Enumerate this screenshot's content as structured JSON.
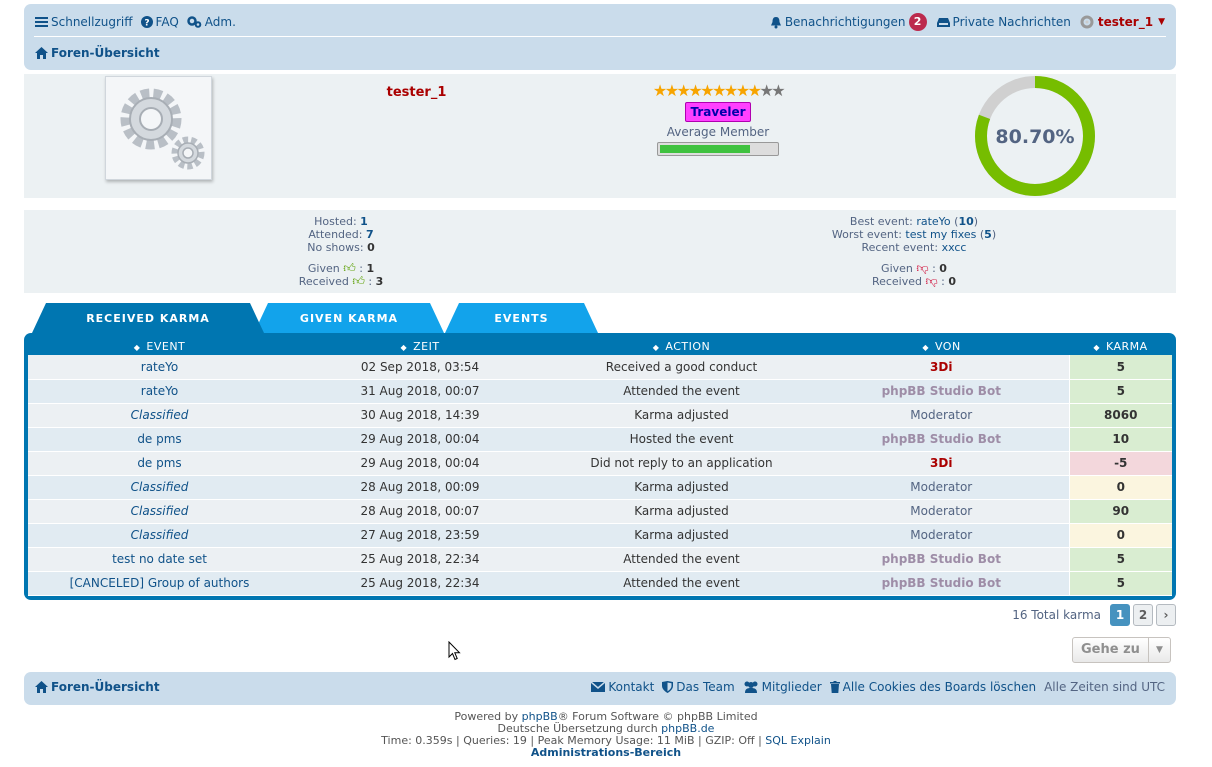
{
  "header": {
    "quicklinks": "Schnellzugriff",
    "faq": "FAQ",
    "adm": "Adm.",
    "notifications": "Benachrichtigungen",
    "notif_count": "2",
    "pm": "Private Nachrichten",
    "username": "tester_1",
    "breadcrumb": "Foren-Übersicht"
  },
  "profile": {
    "name": "tester_1",
    "stars_on": 9,
    "stars_total": 11,
    "rank": "Traveler",
    "rank_title": "Average Member",
    "rank_progress": 0.78,
    "percent": "80.70%",
    "percent_value": 80.7
  },
  "stats": {
    "hosted_label": "Hosted:",
    "hosted": "1",
    "attended_label": "Attended:",
    "attended": "7",
    "noshow_label": "No shows:",
    "noshow": "0",
    "given_label": "Given",
    "given_up": "1",
    "received_label": "Received",
    "received_up": "3",
    "best_label": "Best event:",
    "best_name": "rateYo",
    "best_val": "10",
    "worst_label": "Worst event:",
    "worst_name": "test my fixes",
    "worst_val": "5",
    "recent_label": "Recent event:",
    "recent_name": "xxcc",
    "given_down": "0",
    "received_down": "0"
  },
  "tabs": [
    "RECEIVED KARMA",
    "GIVEN KARMA",
    "EVENTS"
  ],
  "table": {
    "headers": [
      "EVENT",
      "ZEIT",
      "ACTION",
      "VON",
      "KARMA"
    ],
    "rows": [
      {
        "event": "rateYo",
        "italic": false,
        "time": "02 Sep 2018, 03:54",
        "action": "Received a good conduct",
        "von": "3Di",
        "von_type": "red",
        "karma": "5",
        "kclass": "pos"
      },
      {
        "event": "rateYo",
        "italic": false,
        "time": "31 Aug 2018, 00:07",
        "action": "Attended the event",
        "von": "phpBB Studio Bot",
        "von_type": "bot",
        "karma": "5",
        "kclass": "pos"
      },
      {
        "event": "Classified",
        "italic": true,
        "time": "30 Aug 2018, 14:39",
        "action": "Karma adjusted",
        "von": "Moderator",
        "von_type": "mod",
        "karma": "8060",
        "kclass": "pos"
      },
      {
        "event": "de pms",
        "italic": false,
        "time": "29 Aug 2018, 00:04",
        "action": "Hosted the event",
        "von": "phpBB Studio Bot",
        "von_type": "bot",
        "karma": "10",
        "kclass": "pos"
      },
      {
        "event": "de pms",
        "italic": false,
        "time": "29 Aug 2018, 00:04",
        "action": "Did not reply to an application",
        "von": "3Di",
        "von_type": "red",
        "karma": "-5",
        "kclass": "neg"
      },
      {
        "event": "Classified",
        "italic": true,
        "time": "28 Aug 2018, 00:09",
        "action": "Karma adjusted",
        "von": "Moderator",
        "von_type": "mod",
        "karma": "0",
        "kclass": "zero"
      },
      {
        "event": "Classified",
        "italic": true,
        "time": "28 Aug 2018, 00:07",
        "action": "Karma adjusted",
        "von": "Moderator",
        "von_type": "mod",
        "karma": "90",
        "kclass": "pos"
      },
      {
        "event": "Classified",
        "italic": true,
        "time": "27 Aug 2018, 23:59",
        "action": "Karma adjusted",
        "von": "Moderator",
        "von_type": "mod",
        "karma": "0",
        "kclass": "zero"
      },
      {
        "event": "test no date set",
        "italic": false,
        "time": "25 Aug 2018, 22:34",
        "action": "Attended the event",
        "von": "phpBB Studio Bot",
        "von_type": "bot",
        "karma": "5",
        "kclass": "pos"
      },
      {
        "event": "[CANCELED] Group of authors",
        "italic": false,
        "time": "25 Aug 2018, 22:34",
        "action": "Attended the event",
        "von": "phpBB Studio Bot",
        "von_type": "bot",
        "karma": "5",
        "kclass": "pos"
      }
    ]
  },
  "pagination": {
    "total": "16 Total karma",
    "pages": [
      "1",
      "2"
    ],
    "current": "1"
  },
  "jump": {
    "label": "Gehe zu"
  },
  "footer": {
    "home": "Foren-Übersicht",
    "contact": "Kontakt",
    "team": "Das Team",
    "members": "Mitglieder",
    "cookies": "Alle Cookies des Boards löschen",
    "timezone": "Alle Zeiten sind UTC",
    "powered_pre": "Powered by ",
    "powered_link": "phpBB",
    "powered_post": "® Forum Software © phpBB Limited",
    "translation_pre": "Deutsche Übersetzung durch ",
    "translation_link": "phpBB.de",
    "debug": "Time: 0.359s | Queries: 19 | Peak Memory Usage: 11 MiB | GZIP: Off | ",
    "sql_explain": "SQL Explain",
    "admin": "Administrations-Bereich"
  }
}
